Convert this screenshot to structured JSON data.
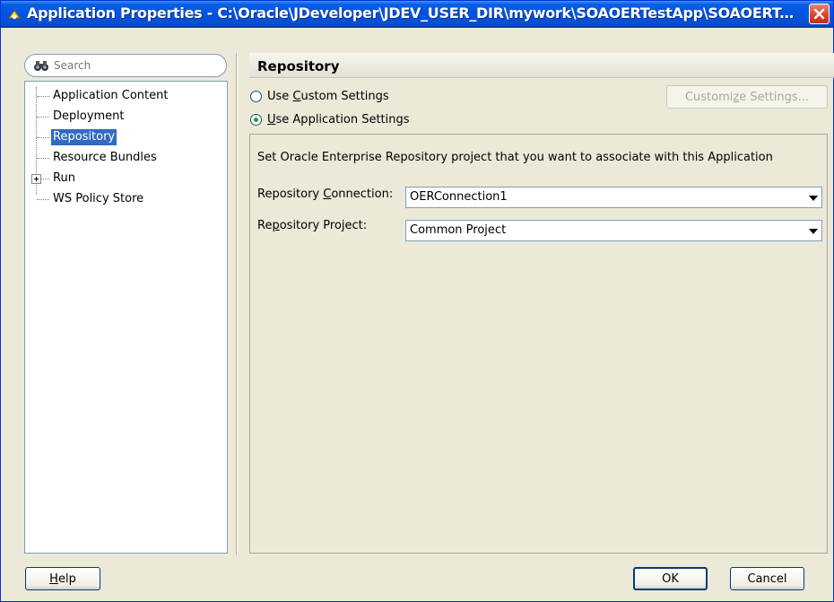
{
  "window": {
    "title": "Application Properties - C:\\Oracle\\JDeveloper\\JDEV_USER_DIR\\mywork\\SOAOERTestApp\\SOAOERTestA..."
  },
  "search": {
    "placeholder": "Search"
  },
  "tree": {
    "items": [
      {
        "label": "Application Content"
      },
      {
        "label": "Deployment"
      },
      {
        "label": "Repository",
        "selected": true
      },
      {
        "label": "Resource Bundles"
      },
      {
        "label": "Run",
        "expandable": true
      },
      {
        "label": "WS Policy Store"
      }
    ]
  },
  "panel": {
    "title": "Repository",
    "radio_custom": {
      "prefix": "Use ",
      "mnemonic": "C",
      "rest": "ustom Settings",
      "checked": false
    },
    "radio_app": {
      "prefix": "",
      "mnemonic": "U",
      "rest": "se Application Settings",
      "checked": true
    },
    "customize_button": {
      "prefix": "Customi",
      "mnemonic": "z",
      "rest": "e Settings..."
    },
    "description": "Set Oracle Enterprise Repository project that you want to associate with this Application",
    "connection_label": {
      "prefix": "Repository ",
      "mnemonic": "C",
      "rest": "onnection:"
    },
    "connection_value": "OERConnection1",
    "project_label": {
      "prefix": "Re",
      "mnemonic": "p",
      "rest": "ository Project:"
    },
    "project_value": "Common Project"
  },
  "footer": {
    "help": {
      "prefix": "",
      "mnemonic": "H",
      "rest": "elp"
    },
    "ok": "OK",
    "cancel": "Cancel"
  },
  "colors": {
    "selection": "#316ac5",
    "titlebar": "#0054e3",
    "close": "#d9452a"
  },
  "icons": {
    "title": "app-properties-icon",
    "search": "binoculars-icon",
    "close": "close-icon"
  }
}
